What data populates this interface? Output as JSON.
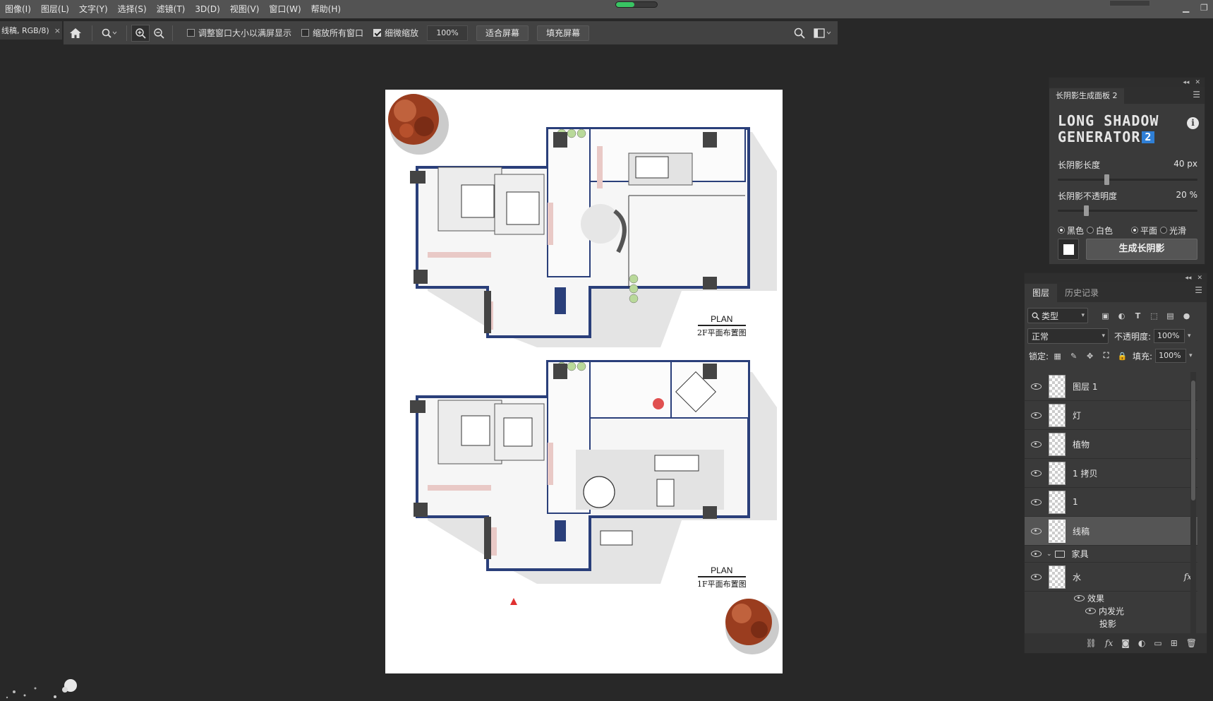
{
  "menu": [
    "图像(I)",
    "图层(L)",
    "文字(Y)",
    "选择(S)",
    "滤镜(T)",
    "3D(D)",
    "视图(V)",
    "窗口(W)",
    "帮助(H)"
  ],
  "progress_fraction": 0.45,
  "doc_tab": {
    "title": "线稿, RGB/8)",
    "close": "×"
  },
  "options": {
    "resize_windows": "调整窗口大小以满屏显示",
    "zoom_all": "缩放所有窗口",
    "scrubby_zoom": "细微缩放",
    "zoom_value": "100%",
    "fit_screen": "适合屏幕",
    "fill_screen": "填充屏幕"
  },
  "plans": [
    {
      "en": "PLAN",
      "cn": "2F平面布置图"
    },
    {
      "en": "PLAN",
      "cn": "1F平面布置图"
    }
  ],
  "lsg": {
    "tab": "长阴影生成面板 2",
    "title_line1": "LONG SHADOW",
    "title_line2": "GENERATOR",
    "badge": "2",
    "length_label": "长阴影长度",
    "length_value": "40 px",
    "opacity_label": "长阴影不透明度",
    "opacity_value": "20 %",
    "length_fraction": 0.35,
    "opacity_fraction": 0.2,
    "opt_black": "黑色",
    "opt_white": "白色",
    "opt_flat": "平面",
    "opt_smooth": "光滑",
    "generate": "生成长阴影"
  },
  "layers_panel": {
    "tab_layers": "图层",
    "tab_history": "历史记录",
    "filter": "类型",
    "blend": "正常",
    "opacity_label": "不透明度:",
    "opacity_value": "100%",
    "lock_label": "锁定:",
    "fill_label": "填充:",
    "fill_value": "100%",
    "layers": [
      "图层 1",
      "灯",
      "植物",
      "1 拷贝",
      "1",
      "线稿"
    ],
    "group": "家具",
    "child": "水",
    "effects": "效果",
    "effect_1": "内发光",
    "effect_2": "投影",
    "fx": "fx"
  },
  "colors": {
    "wall": "#2a3f7a",
    "shadow": "#d9d9d9",
    "accent_pink": "#e9c9c6",
    "plant_green": "#b9d99a",
    "tree": "#9a3d1f"
  }
}
